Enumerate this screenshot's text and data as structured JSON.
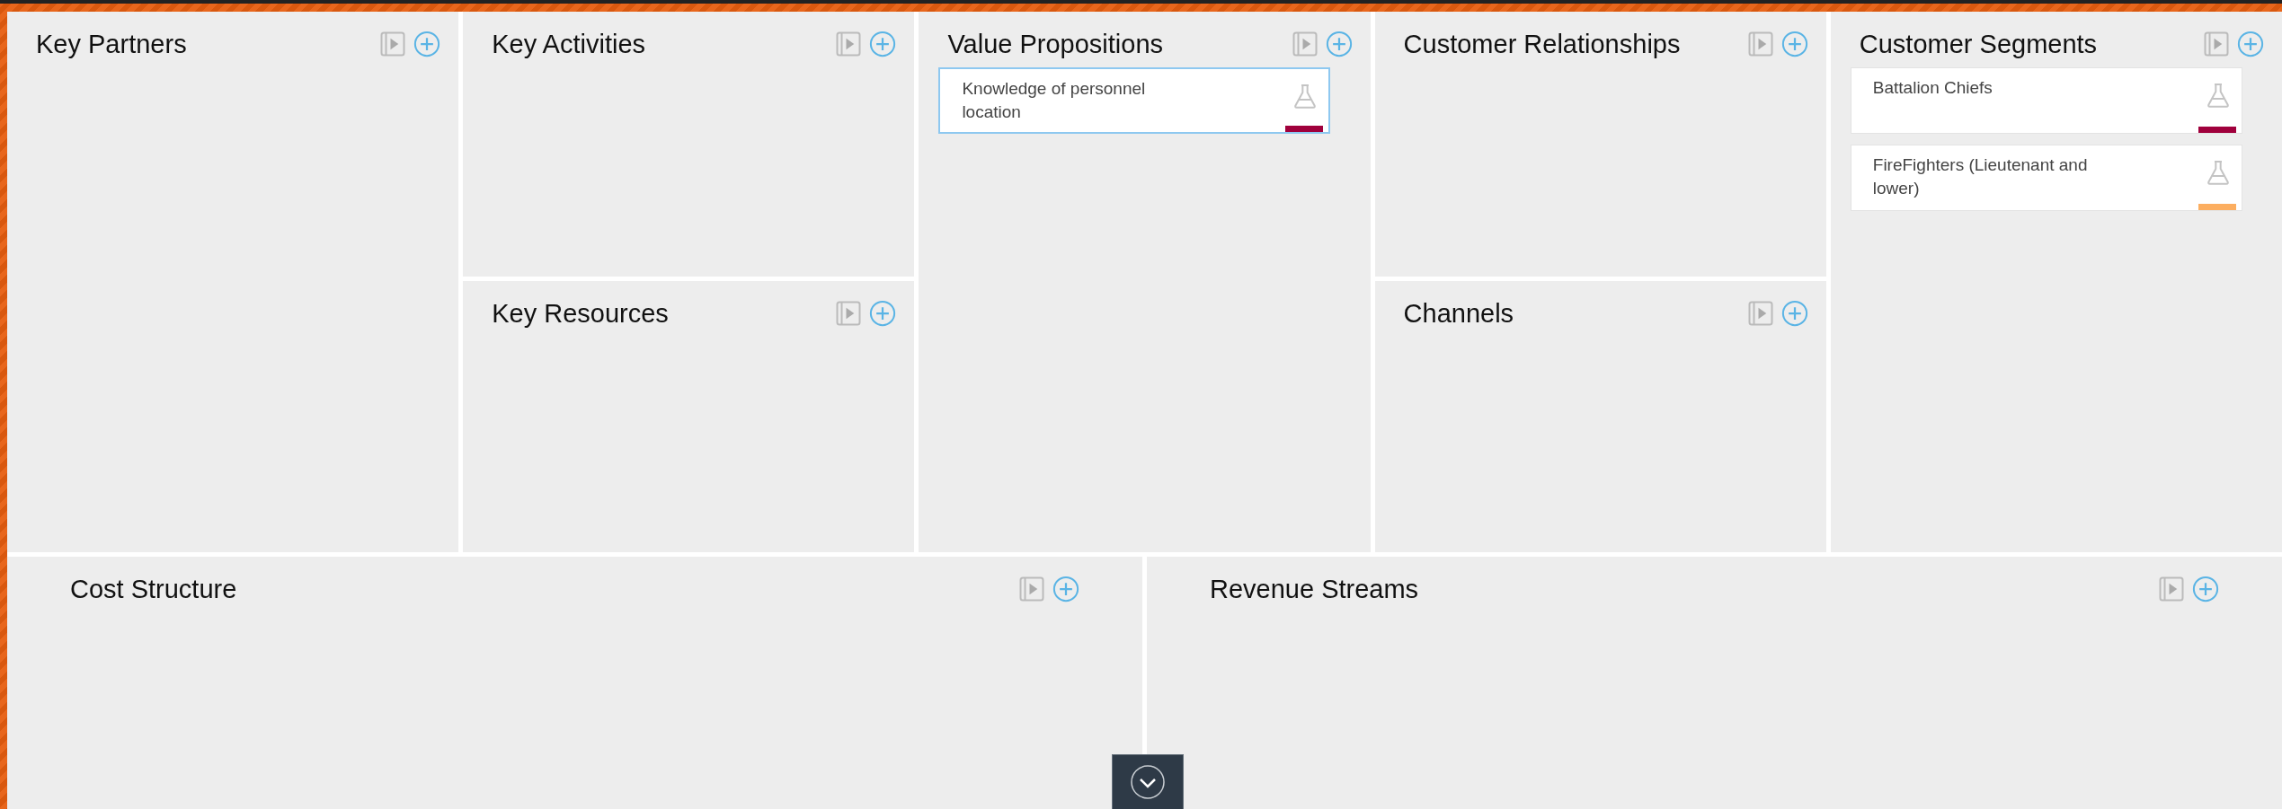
{
  "top_blocks": [
    {
      "title": "Key Partners"
    },
    {
      "title": "Key Activities"
    },
    {
      "title": "Key Resources"
    },
    {
      "title": "Value Propositions",
      "cards": [
        {
          "text": "Knowledge of personnel location",
          "color": "#a0003c",
          "selected": true
        }
      ]
    },
    {
      "title": "Customer Relationships"
    },
    {
      "title": "Channels"
    },
    {
      "title": "Customer Segments",
      "cards": [
        {
          "text": "Battalion Chiefs",
          "color": "#a0003c",
          "selected": false
        },
        {
          "text": "FireFighters (Lieutenant and lower)",
          "color": "#fcae60",
          "selected": false
        }
      ]
    }
  ],
  "bottom_blocks": [
    {
      "title": "Cost Structure"
    },
    {
      "title": "Revenue Streams"
    }
  ]
}
